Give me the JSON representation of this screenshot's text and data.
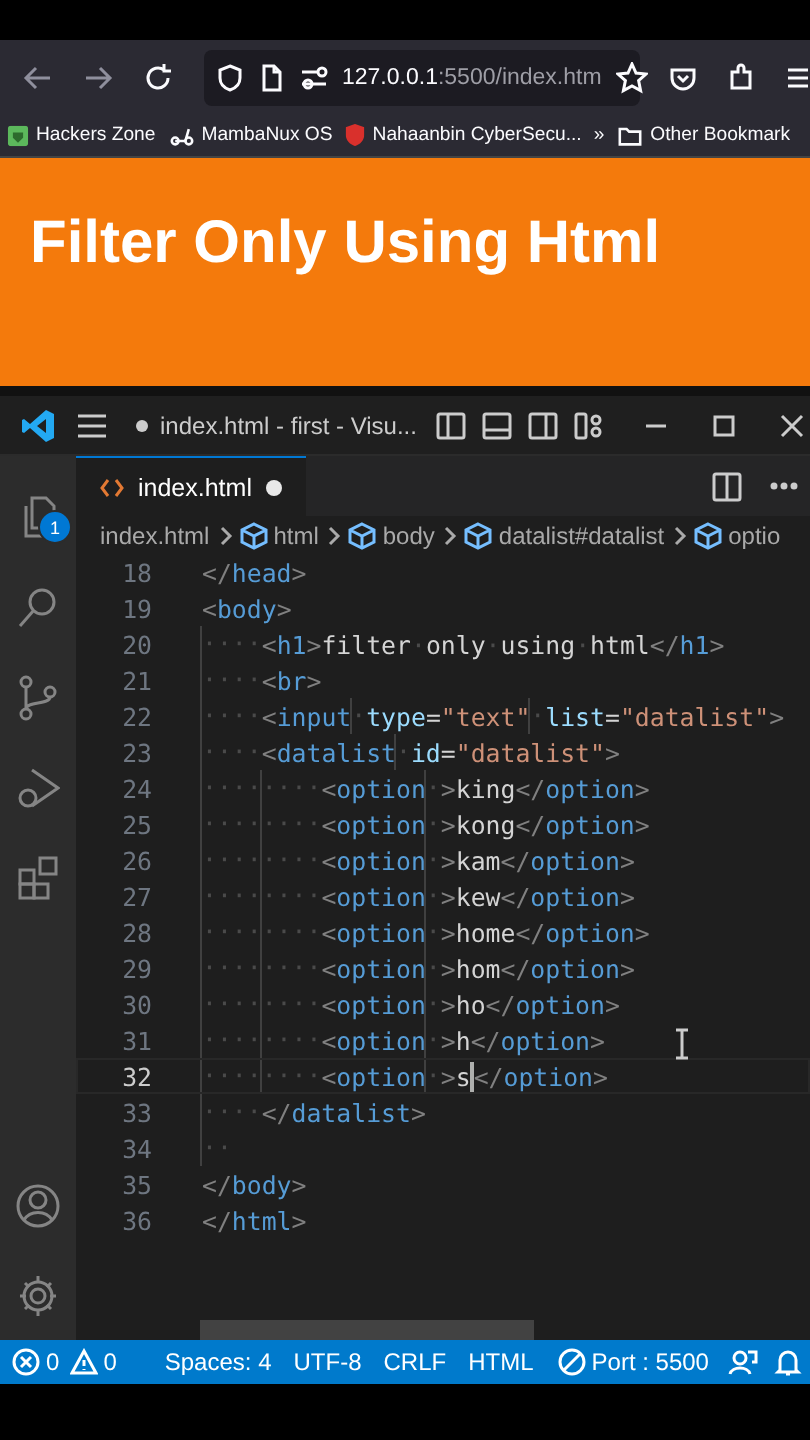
{
  "browser": {
    "nav": [
      {
        "kind": "back",
        "disabled": true
      },
      {
        "kind": "forward",
        "disabled": true
      },
      {
        "kind": "reload",
        "disabled": false
      }
    ],
    "address": {
      "host": "127.0.0.1",
      "rest": ":5500/index.htm"
    },
    "bookmarks": [
      {
        "kind": "hacker",
        "label": "Hackers Zone"
      },
      {
        "kind": "bike",
        "label": "MambaNux OS"
      },
      {
        "kind": "shield",
        "label": "Nahaanbin CyberSecu..."
      },
      {
        "kind": "more",
        "label": "»"
      },
      {
        "kind": "folder",
        "label": "Other Bookmark"
      }
    ]
  },
  "banner": {
    "title": "Filter Only Using Html"
  },
  "editor": {
    "title": "index.html - first - Visu...",
    "title_dirty": true,
    "explorer_badge": "1",
    "tab": {
      "label": "index.html",
      "dirty": true,
      "selected": true
    },
    "breadcrumbs": [
      "index.html",
      "html",
      "body",
      "datalist#datalist",
      "optio"
    ],
    "lines": [
      {
        "number": "18",
        "current": false,
        "tokens": [
          {
            "kind": "punct",
            "text": "</"
          },
          {
            "kind": "tag",
            "text": "head"
          },
          {
            "kind": "punct",
            "text": ">"
          }
        ]
      },
      {
        "number": "19",
        "current": false,
        "tokens": [
          {
            "kind": "punct",
            "text": "<"
          },
          {
            "kind": "tag",
            "text": "body"
          },
          {
            "kind": "punct",
            "text": ">"
          }
        ]
      },
      {
        "number": "20",
        "current": false,
        "tokens": [
          {
            "kind": "space",
            "text": "····"
          },
          {
            "kind": "punct",
            "text": "<"
          },
          {
            "kind": "tag",
            "text": "h1"
          },
          {
            "kind": "punct",
            "text": ">"
          },
          {
            "kind": "text",
            "text": "filter·only·using·html"
          },
          {
            "kind": "punct",
            "text": "</"
          },
          {
            "kind": "tag",
            "text": "h1"
          },
          {
            "kind": "punct",
            "text": ">"
          }
        ]
      },
      {
        "number": "21",
        "current": false,
        "tokens": [
          {
            "kind": "space",
            "text": "····"
          },
          {
            "kind": "punct",
            "text": "<"
          },
          {
            "kind": "tag",
            "text": "br"
          },
          {
            "kind": "punct",
            "text": ">"
          }
        ]
      },
      {
        "number": "22",
        "current": false,
        "tokens": [
          {
            "kind": "space",
            "text": "····"
          },
          {
            "kind": "punct",
            "text": "<"
          },
          {
            "kind": "tag",
            "text": "input"
          },
          {
            "kind": "space",
            "text": "·"
          },
          {
            "kind": "attr",
            "text": "type"
          },
          {
            "kind": "text",
            "text": "="
          },
          {
            "kind": "string",
            "text": "\"text\""
          },
          {
            "kind": "space",
            "text": "·"
          },
          {
            "kind": "attr",
            "text": "list"
          },
          {
            "kind": "text",
            "text": "="
          },
          {
            "kind": "string",
            "text": "\"datalist\""
          },
          {
            "kind": "punct",
            "text": ">"
          }
        ]
      },
      {
        "number": "23",
        "current": false,
        "tokens": [
          {
            "kind": "space",
            "text": "····"
          },
          {
            "kind": "punct",
            "text": "<"
          },
          {
            "kind": "tag",
            "text": "datalist"
          },
          {
            "kind": "space",
            "text": "·"
          },
          {
            "kind": "attr",
            "text": "id"
          },
          {
            "kind": "text",
            "text": "="
          },
          {
            "kind": "string",
            "text": "\"datalist\""
          },
          {
            "kind": "punct",
            "text": ">"
          }
        ]
      },
      {
        "number": "24",
        "current": false,
        "tokens": [
          {
            "kind": "space",
            "text": "········"
          },
          {
            "kind": "punct",
            "text": "<"
          },
          {
            "kind": "tag",
            "text": "option"
          },
          {
            "kind": "space",
            "text": "·"
          },
          {
            "kind": "punct",
            "text": ">"
          },
          {
            "kind": "text",
            "text": "king"
          },
          {
            "kind": "punct",
            "text": "</"
          },
          {
            "kind": "tag",
            "text": "option"
          },
          {
            "kind": "punct",
            "text": ">"
          }
        ]
      },
      {
        "number": "25",
        "current": false,
        "tokens": [
          {
            "kind": "space",
            "text": "········"
          },
          {
            "kind": "punct",
            "text": "<"
          },
          {
            "kind": "tag",
            "text": "option"
          },
          {
            "kind": "space",
            "text": "·"
          },
          {
            "kind": "punct",
            "text": ">"
          },
          {
            "kind": "text",
            "text": "kong"
          },
          {
            "kind": "punct",
            "text": "</"
          },
          {
            "kind": "tag",
            "text": "option"
          },
          {
            "kind": "punct",
            "text": ">"
          }
        ]
      },
      {
        "number": "26",
        "current": false,
        "tokens": [
          {
            "kind": "space",
            "text": "········"
          },
          {
            "kind": "punct",
            "text": "<"
          },
          {
            "kind": "tag",
            "text": "option"
          },
          {
            "kind": "space",
            "text": "·"
          },
          {
            "kind": "punct",
            "text": ">"
          },
          {
            "kind": "text",
            "text": "kam"
          },
          {
            "kind": "punct",
            "text": "</"
          },
          {
            "kind": "tag",
            "text": "option"
          },
          {
            "kind": "punct",
            "text": ">"
          }
        ]
      },
      {
        "number": "27",
        "current": false,
        "tokens": [
          {
            "kind": "space",
            "text": "········"
          },
          {
            "kind": "punct",
            "text": "<"
          },
          {
            "kind": "tag",
            "text": "option"
          },
          {
            "kind": "space",
            "text": "·"
          },
          {
            "kind": "punct",
            "text": ">"
          },
          {
            "kind": "text",
            "text": "kew"
          },
          {
            "kind": "punct",
            "text": "</"
          },
          {
            "kind": "tag",
            "text": "option"
          },
          {
            "kind": "punct",
            "text": ">"
          }
        ]
      },
      {
        "number": "28",
        "current": false,
        "tokens": [
          {
            "kind": "space",
            "text": "········"
          },
          {
            "kind": "punct",
            "text": "<"
          },
          {
            "kind": "tag",
            "text": "option"
          },
          {
            "kind": "space",
            "text": "·"
          },
          {
            "kind": "punct",
            "text": ">"
          },
          {
            "kind": "text",
            "text": "home"
          },
          {
            "kind": "punct",
            "text": "</"
          },
          {
            "kind": "tag",
            "text": "option"
          },
          {
            "kind": "punct",
            "text": ">"
          }
        ]
      },
      {
        "number": "29",
        "current": false,
        "tokens": [
          {
            "kind": "space",
            "text": "········"
          },
          {
            "kind": "punct",
            "text": "<"
          },
          {
            "kind": "tag",
            "text": "option"
          },
          {
            "kind": "space",
            "text": "·"
          },
          {
            "kind": "punct",
            "text": ">"
          },
          {
            "kind": "text",
            "text": "hom"
          },
          {
            "kind": "punct",
            "text": "</"
          },
          {
            "kind": "tag",
            "text": "option"
          },
          {
            "kind": "punct",
            "text": ">"
          }
        ]
      },
      {
        "number": "30",
        "current": false,
        "tokens": [
          {
            "kind": "space",
            "text": "········"
          },
          {
            "kind": "punct",
            "text": "<"
          },
          {
            "kind": "tag",
            "text": "option"
          },
          {
            "kind": "space",
            "text": "·"
          },
          {
            "kind": "punct",
            "text": ">"
          },
          {
            "kind": "text",
            "text": "ho"
          },
          {
            "kind": "punct",
            "text": "</"
          },
          {
            "kind": "tag",
            "text": "option"
          },
          {
            "kind": "punct",
            "text": ">"
          }
        ]
      },
      {
        "number": "31",
        "current": false,
        "tokens": [
          {
            "kind": "space",
            "text": "········"
          },
          {
            "kind": "punct",
            "text": "<"
          },
          {
            "kind": "tag",
            "text": "option"
          },
          {
            "kind": "space",
            "text": "·"
          },
          {
            "kind": "punct",
            "text": ">"
          },
          {
            "kind": "text",
            "text": "h"
          },
          {
            "kind": "punct",
            "text": "</"
          },
          {
            "kind": "tag",
            "text": "option"
          },
          {
            "kind": "punct",
            "text": ">"
          }
        ]
      },
      {
        "number": "32",
        "current": true,
        "tokens": [
          {
            "kind": "space",
            "text": "········"
          },
          {
            "kind": "punct",
            "text": "<"
          },
          {
            "kind": "tag",
            "text": "option"
          },
          {
            "kind": "space",
            "text": "·"
          },
          {
            "kind": "punct",
            "text": ">"
          },
          {
            "kind": "text",
            "text": "s"
          },
          {
            "kind": "punct",
            "text": "</"
          },
          {
            "kind": "tag",
            "text": "option"
          },
          {
            "kind": "punct",
            "text": ">"
          }
        ]
      },
      {
        "number": "33",
        "current": false,
        "tokens": [
          {
            "kind": "space",
            "text": "····"
          },
          {
            "kind": "punct",
            "text": "</"
          },
          {
            "kind": "tag",
            "text": "datalist"
          },
          {
            "kind": "punct",
            "text": ">"
          }
        ]
      },
      {
        "number": "34",
        "current": false,
        "tokens": [
          {
            "kind": "space",
            "text": "··"
          }
        ]
      },
      {
        "number": "35",
        "current": false,
        "tokens": [
          {
            "kind": "punct",
            "text": "</"
          },
          {
            "kind": "tag",
            "text": "body"
          },
          {
            "kind": "punct",
            "text": ">"
          }
        ]
      },
      {
        "number": "36",
        "current": false,
        "tokens": [
          {
            "kind": "punct",
            "text": "</"
          },
          {
            "kind": "tag",
            "text": "html"
          },
          {
            "kind": "punct",
            "text": ">"
          }
        ]
      }
    ]
  },
  "status_bar": {
    "errors": "0",
    "warnings": "0",
    "items": [
      "Spaces: 4",
      "UTF-8",
      "CRLF",
      "HTML"
    ],
    "port": "Port : 5500"
  }
}
